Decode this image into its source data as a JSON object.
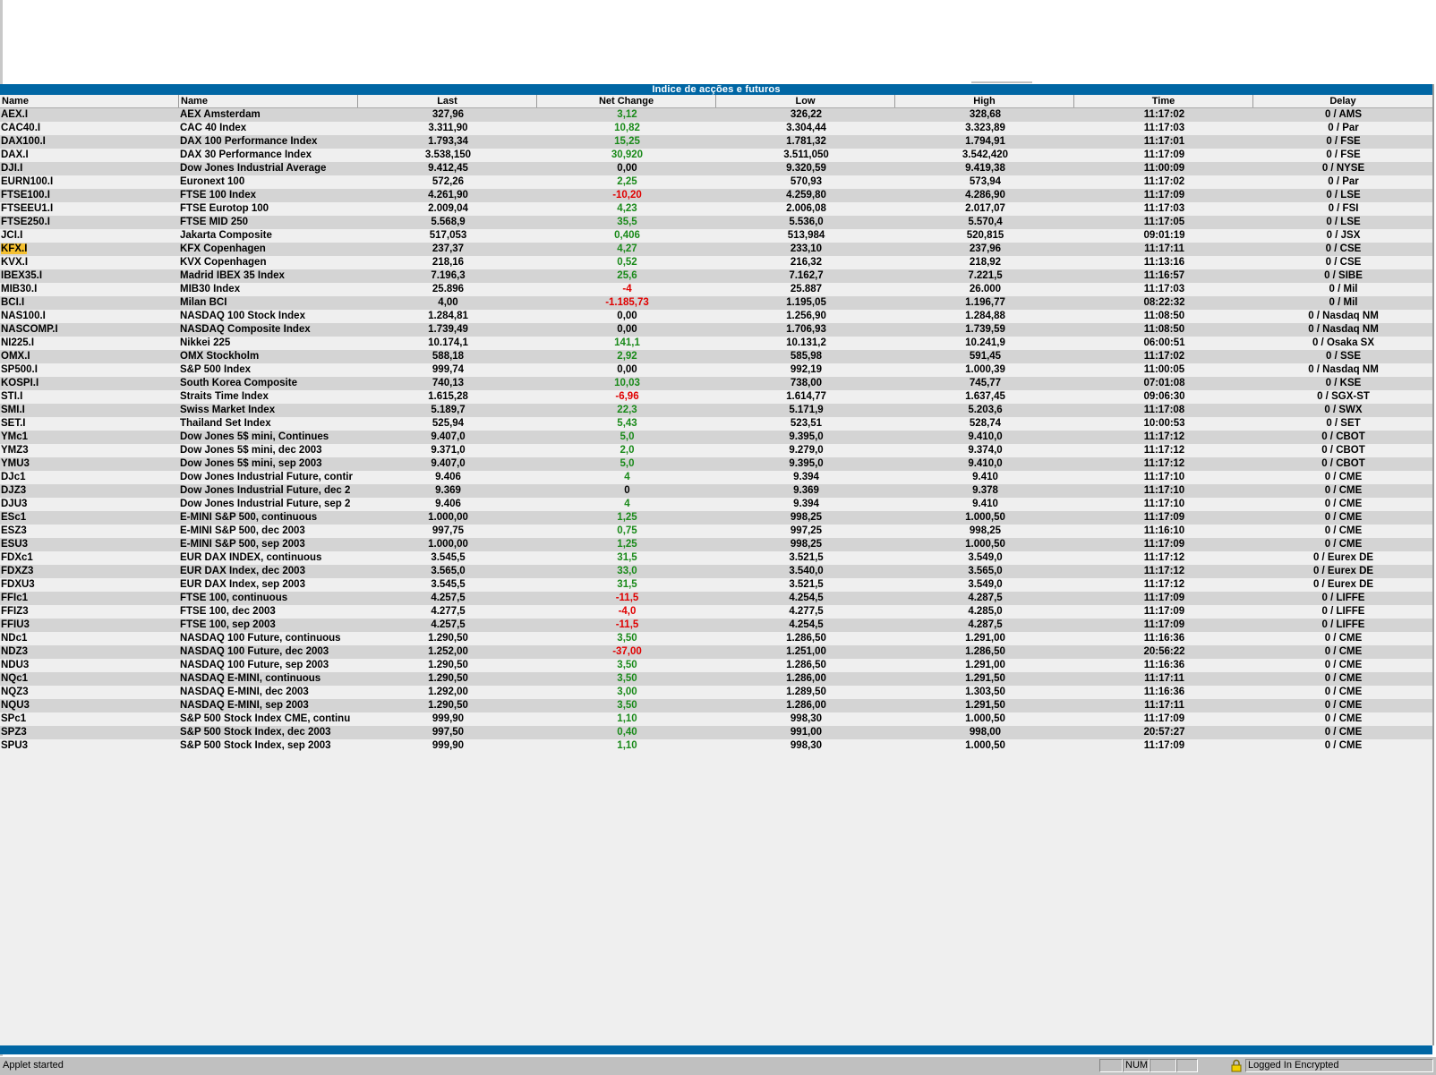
{
  "window": {
    "title": "Indice de acções e futuros"
  },
  "columns": [
    "Name",
    "Name",
    "Last",
    "Net Change",
    "Low",
    "High",
    "Time",
    "Delay"
  ],
  "selected_row": "KFX.I",
  "colors": {
    "title_bar": "#0066a4",
    "row_alt": "#d4d4d4",
    "row_plain": "#efefef",
    "positive": "#1a8a1a",
    "negative": "#e00000",
    "selection": "#f5c030"
  },
  "rows": [
    [
      "AEX.I",
      "AEX Amsterdam",
      "327,96",
      "3,12",
      "326,22",
      "328,68",
      "11:17:02",
      "0 / AMS"
    ],
    [
      "CAC40.I",
      "CAC 40 Index",
      "3.311,90",
      "10,82",
      "3.304,44",
      "3.323,89",
      "11:17:03",
      "0 / Par"
    ],
    [
      "DAX100.I",
      "DAX 100 Performance Index",
      "1.793,34",
      "15,25",
      "1.781,32",
      "1.794,91",
      "11:17:01",
      "0 / FSE"
    ],
    [
      "DAX.I",
      "DAX 30 Performance Index",
      "3.538,150",
      "30,920",
      "3.511,050",
      "3.542,420",
      "11:17:09",
      "0 / FSE"
    ],
    [
      "DJI.I",
      "Dow Jones Industrial Average",
      "9.412,45",
      "0,00",
      "9.320,59",
      "9.419,38",
      "11:00:09",
      "0 / NYSE"
    ],
    [
      "EURN100.I",
      "Euronext 100",
      "572,26",
      "2,25",
      "570,93",
      "573,94",
      "11:17:02",
      "0 / Par"
    ],
    [
      "FTSE100.I",
      "FTSE 100 Index",
      "4.261,90",
      "-10,20",
      "4.259,80",
      "4.286,90",
      "11:17:09",
      "0 / LSE"
    ],
    [
      "FTSEEU1.I",
      "FTSE Eurotop 100",
      "2.009,04",
      "4,23",
      "2.006,08",
      "2.017,07",
      "11:17:03",
      "0 / FSI"
    ],
    [
      "FTSE250.I",
      "FTSE MID 250",
      "5.568,9",
      "35,5",
      "5.536,0",
      "5.570,4",
      "11:17:05",
      "0 / LSE"
    ],
    [
      "JCI.I",
      "Jakarta Composite",
      "517,053",
      "0,406",
      "513,984",
      "520,815",
      "09:01:19",
      "0 / JSX"
    ],
    [
      "KFX.I",
      "KFX Copenhagen",
      "237,37",
      "4,27",
      "233,10",
      "237,96",
      "11:17:11",
      "0 / CSE"
    ],
    [
      "KVX.I",
      "KVX Copenhagen",
      "218,16",
      "0,52",
      "216,32",
      "218,92",
      "11:13:16",
      "0 / CSE"
    ],
    [
      "IBEX35.I",
      "Madrid IBEX 35 Index",
      "7.196,3",
      "25,6",
      "7.162,7",
      "7.221,5",
      "11:16:57",
      "0 / SIBE"
    ],
    [
      "MIB30.I",
      "MIB30 Index",
      "25.896",
      "-4",
      "25.887",
      "26.000",
      "11:17:03",
      "0 / Mil"
    ],
    [
      "BCI.I",
      "Milan BCI",
      "4,00",
      "-1.185,73",
      "1.195,05",
      "1.196,77",
      "08:22:32",
      "0 / Mil"
    ],
    [
      "NAS100.I",
      "NASDAQ 100 Stock Index",
      "1.284,81",
      "0,00",
      "1.256,90",
      "1.284,88",
      "11:08:50",
      "0 / Nasdaq NM"
    ],
    [
      "NASCOMP.I",
      "NASDAQ Composite Index",
      "1.739,49",
      "0,00",
      "1.706,93",
      "1.739,59",
      "11:08:50",
      "0 / Nasdaq NM"
    ],
    [
      "NI225.I",
      "Nikkei 225",
      "10.174,1",
      "141,1",
      "10.131,2",
      "10.241,9",
      "06:00:51",
      "0 / Osaka SX"
    ],
    [
      "OMX.I",
      "OMX Stockholm",
      "588,18",
      "2,92",
      "585,98",
      "591,45",
      "11:17:02",
      "0 / SSE"
    ],
    [
      "SP500.I",
      "S&P 500 Index",
      "999,74",
      "0,00",
      "992,19",
      "1.000,39",
      "11:00:05",
      "0 / Nasdaq NM"
    ],
    [
      "KOSPI.I",
      "South Korea Composite",
      "740,13",
      "10,03",
      "738,00",
      "745,77",
      "07:01:08",
      "0 / KSE"
    ],
    [
      "STI.I",
      "Straits Time Index",
      "1.615,28",
      "-6,96",
      "1.614,77",
      "1.637,45",
      "09:06:30",
      "0 / SGX-ST"
    ],
    [
      "SMI.I",
      "Swiss Market Index",
      "5.189,7",
      "22,3",
      "5.171,9",
      "5.203,6",
      "11:17:08",
      "0 / SWX"
    ],
    [
      "SET.I",
      "Thailand Set Index",
      "525,94",
      "5,43",
      "523,51",
      "528,74",
      "10:00:53",
      "0 / SET"
    ],
    [
      "YMc1",
      "Dow Jones 5$ mini, Continues",
      "9.407,0",
      "5,0",
      "9.395,0",
      "9.410,0",
      "11:17:12",
      "0 / CBOT"
    ],
    [
      "YMZ3",
      "Dow Jones 5$ mini, dec 2003",
      "9.371,0",
      "2,0",
      "9.279,0",
      "9.374,0",
      "11:17:12",
      "0 / CBOT"
    ],
    [
      "YMU3",
      "Dow Jones 5$ mini, sep 2003",
      "9.407,0",
      "5,0",
      "9.395,0",
      "9.410,0",
      "11:17:12",
      "0 / CBOT"
    ],
    [
      "DJc1",
      "Dow Jones Industrial Future, contir",
      "9.406",
      "4",
      "9.394",
      "9.410",
      "11:17:10",
      "0 / CME"
    ],
    [
      "DJZ3",
      "Dow Jones Industrial Future, dec 2",
      "9.369",
      "0",
      "9.369",
      "9.378",
      "11:17:10",
      "0 / CME"
    ],
    [
      "DJU3",
      "Dow Jones Industrial Future, sep 2",
      "9.406",
      "4",
      "9.394",
      "9.410",
      "11:17:10",
      "0 / CME"
    ],
    [
      "ESc1",
      "E-MINI S&P 500, continuous",
      "1.000,00",
      "1,25",
      "998,25",
      "1.000,50",
      "11:17:09",
      "0 / CME"
    ],
    [
      "ESZ3",
      "E-MINI S&P 500, dec 2003",
      "997,75",
      "0,75",
      "997,25",
      "998,25",
      "11:16:10",
      "0 / CME"
    ],
    [
      "ESU3",
      "E-MINI S&P 500, sep 2003",
      "1.000,00",
      "1,25",
      "998,25",
      "1.000,50",
      "11:17:09",
      "0 / CME"
    ],
    [
      "FDXc1",
      "EUR DAX INDEX, continuous",
      "3.545,5",
      "31,5",
      "3.521,5",
      "3.549,0",
      "11:17:12",
      "0 / Eurex DE"
    ],
    [
      "FDXZ3",
      "EUR DAX Index, dec 2003",
      "3.565,0",
      "33,0",
      "3.540,0",
      "3.565,0",
      "11:17:12",
      "0 / Eurex DE"
    ],
    [
      "FDXU3",
      "EUR DAX Index, sep 2003",
      "3.545,5",
      "31,5",
      "3.521,5",
      "3.549,0",
      "11:17:12",
      "0 / Eurex DE"
    ],
    [
      "FFIc1",
      "FTSE 100, continuous",
      "4.257,5",
      "-11,5",
      "4.254,5",
      "4.287,5",
      "11:17:09",
      "0 / LIFFE"
    ],
    [
      "FFIZ3",
      "FTSE 100, dec 2003",
      "4.277,5",
      "-4,0",
      "4.277,5",
      "4.285,0",
      "11:17:09",
      "0 / LIFFE"
    ],
    [
      "FFIU3",
      "FTSE 100, sep 2003",
      "4.257,5",
      "-11,5",
      "4.254,5",
      "4.287,5",
      "11:17:09",
      "0 / LIFFE"
    ],
    [
      "NDc1",
      "NASDAQ 100 Future, continuous",
      "1.290,50",
      "3,50",
      "1.286,50",
      "1.291,00",
      "11:16:36",
      "0 / CME"
    ],
    [
      "NDZ3",
      "NASDAQ 100 Future, dec 2003",
      "1.252,00",
      "-37,00",
      "1.251,00",
      "1.286,50",
      "20:56:22",
      "0 / CME"
    ],
    [
      "NDU3",
      "NASDAQ 100 Future, sep 2003",
      "1.290,50",
      "3,50",
      "1.286,50",
      "1.291,00",
      "11:16:36",
      "0 / CME"
    ],
    [
      "NQc1",
      "NASDAQ E-MINI, continuous",
      "1.290,50",
      "3,50",
      "1.286,00",
      "1.291,50",
      "11:17:11",
      "0 / CME"
    ],
    [
      "NQZ3",
      "NASDAQ E-MINI, dec 2003",
      "1.292,00",
      "3,00",
      "1.289,50",
      "1.303,50",
      "11:16:36",
      "0 / CME"
    ],
    [
      "NQU3",
      "NASDAQ E-MINI, sep 2003",
      "1.290,50",
      "3,50",
      "1.286,00",
      "1.291,50",
      "11:17:11",
      "0 / CME"
    ],
    [
      "SPc1",
      "S&P 500 Stock Index CME, continu",
      "999,90",
      "1,10",
      "998,30",
      "1.000,50",
      "11:17:09",
      "0 / CME"
    ],
    [
      "SPZ3",
      "S&P 500 Stock Index, dec 2003",
      "997,50",
      "0,40",
      "991,00",
      "998,00",
      "20:57:27",
      "0 / CME"
    ],
    [
      "SPU3",
      "S&P 500 Stock Index, sep 2003",
      "999,90",
      "1,10",
      "998,30",
      "1.000,50",
      "11:17:09",
      "0 / CME"
    ]
  ],
  "status_bar": {
    "message": "Applet started",
    "num_indicator": "NUM",
    "lock_icon": "lock-icon",
    "security_text": "Logged In Encrypted"
  }
}
